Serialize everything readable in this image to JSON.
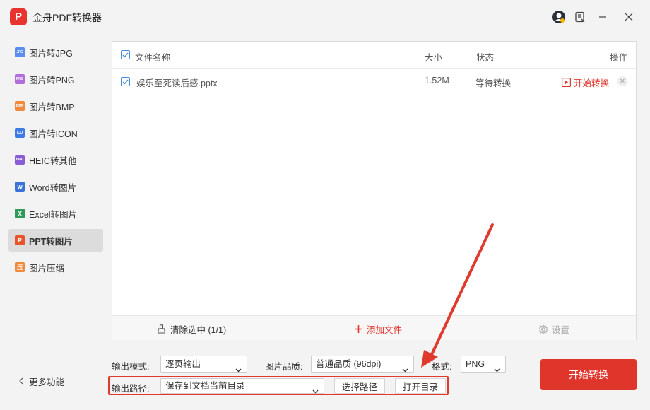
{
  "app": {
    "title": "金舟PDF转换器",
    "logo_text": "P"
  },
  "sidebar": {
    "items": [
      {
        "label": "图片转JPG",
        "icon": "jpg-icon",
        "badge": "JPG",
        "color": "#5b8def"
      },
      {
        "label": "图片转PNG",
        "icon": "png-icon",
        "badge": "PNG",
        "color": "#b06fd8"
      },
      {
        "label": "图片转BMP",
        "icon": "bmp-icon",
        "badge": "BMP",
        "color": "#f08a3c"
      },
      {
        "label": "图片转ICON",
        "icon": "icon-format-icon",
        "badge": "ICO",
        "color": "#3d7be6"
      },
      {
        "label": "HEIC转其他",
        "icon": "heic-icon",
        "badge": "HEIC",
        "color": "#8a5cd6"
      },
      {
        "label": "Word转图片",
        "icon": "word-icon",
        "badge": "W",
        "color": "#3b73d9"
      },
      {
        "label": "Excel转图片",
        "icon": "excel-icon",
        "badge": "X",
        "color": "#2e9b57"
      },
      {
        "label": "PPT转图片",
        "icon": "ppt-icon",
        "badge": "P",
        "color": "#e8552c"
      },
      {
        "label": "图片压缩",
        "icon": "compress-icon",
        "badge": "压",
        "color": "#f08a3c"
      }
    ],
    "active_index": 7,
    "more_label": "更多功能"
  },
  "table": {
    "headers": {
      "name": "文件名称",
      "size": "大小",
      "status": "状态",
      "action": "操作"
    },
    "rows": [
      {
        "name": "娱乐至死读后感.pptx",
        "size": "1.52M",
        "status": "等待转换",
        "action": "开始转换",
        "checked": true
      }
    ]
  },
  "panel_footer": {
    "clear_label": "清除选中 (1/1)",
    "add_label": "添加文件",
    "settings_label": "设置"
  },
  "options": {
    "mode_label": "输出模式:",
    "mode_value": "逐页输出",
    "quality_label": "图片品质:",
    "quality_value": "普通品质 (96dpi)",
    "format_label": "格式:",
    "format_value": "PNG",
    "path_label": "输出路径:",
    "path_value": "保存到文档当前目录",
    "choose_path": "选择路径",
    "open_dir": "打开目录"
  },
  "start_button": "开始转换",
  "colors": {
    "accent": "#e0352b",
    "checkbox": "#4a90d9",
    "active_item_bg": "#dcdcdc"
  }
}
